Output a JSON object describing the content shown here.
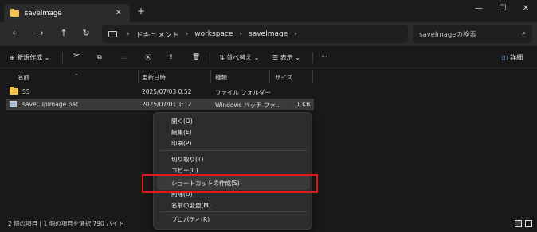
{
  "window": {
    "tab_title": "saveImage",
    "tab_close": "×",
    "new_tab": "+",
    "minimize": "—",
    "maximize": "☐",
    "close": "✕"
  },
  "nav": {
    "back": "←",
    "forward": "→",
    "up": "↑",
    "refresh": "↻",
    "breadcrumbs": [
      "ドキュメント",
      "workspace",
      "saveImage"
    ],
    "sep": "›",
    "search_placeholder": "saveImageの検索",
    "search_icon": "⌕"
  },
  "toolbar": {
    "new_label": "新規作成",
    "new_caret": "⌄",
    "cut_icon": "✂",
    "copy_icon": "⧉",
    "paste_icon": "▭",
    "rename_icon": "Ⓐ",
    "share_icon": "⇪",
    "delete_icon": "🗑",
    "sort_label": "並べ替え",
    "view_label": "表示",
    "more": "···",
    "details_label": "詳細"
  },
  "columns": {
    "name": "名前",
    "date": "更新日時",
    "type": "種類",
    "size": "サイズ"
  },
  "files": [
    {
      "name": "SS",
      "date": "2025/07/03 0:52",
      "type": "ファイル フォルダー",
      "size": ""
    },
    {
      "name": "saveClipImage.bat",
      "date": "2025/07/01 1:12",
      "type": "Windows バッチ ファ...",
      "size": "1 KB"
    }
  ],
  "context_menu": {
    "items": [
      "開く(O)",
      "編集(E)",
      "印刷(P)",
      "切り取り(T)",
      "コピー(C)",
      "ショートカットの作成(S)",
      "削除(D)",
      "名前の変更(M)",
      "プロパティ(R)"
    ]
  },
  "status": {
    "text": "2 個の項目  |  1 個の項目を選択  790 バイト  |"
  },
  "colors": {
    "highlight_box": "#e01919",
    "folder": "#f2c14e",
    "background": "#191919"
  }
}
